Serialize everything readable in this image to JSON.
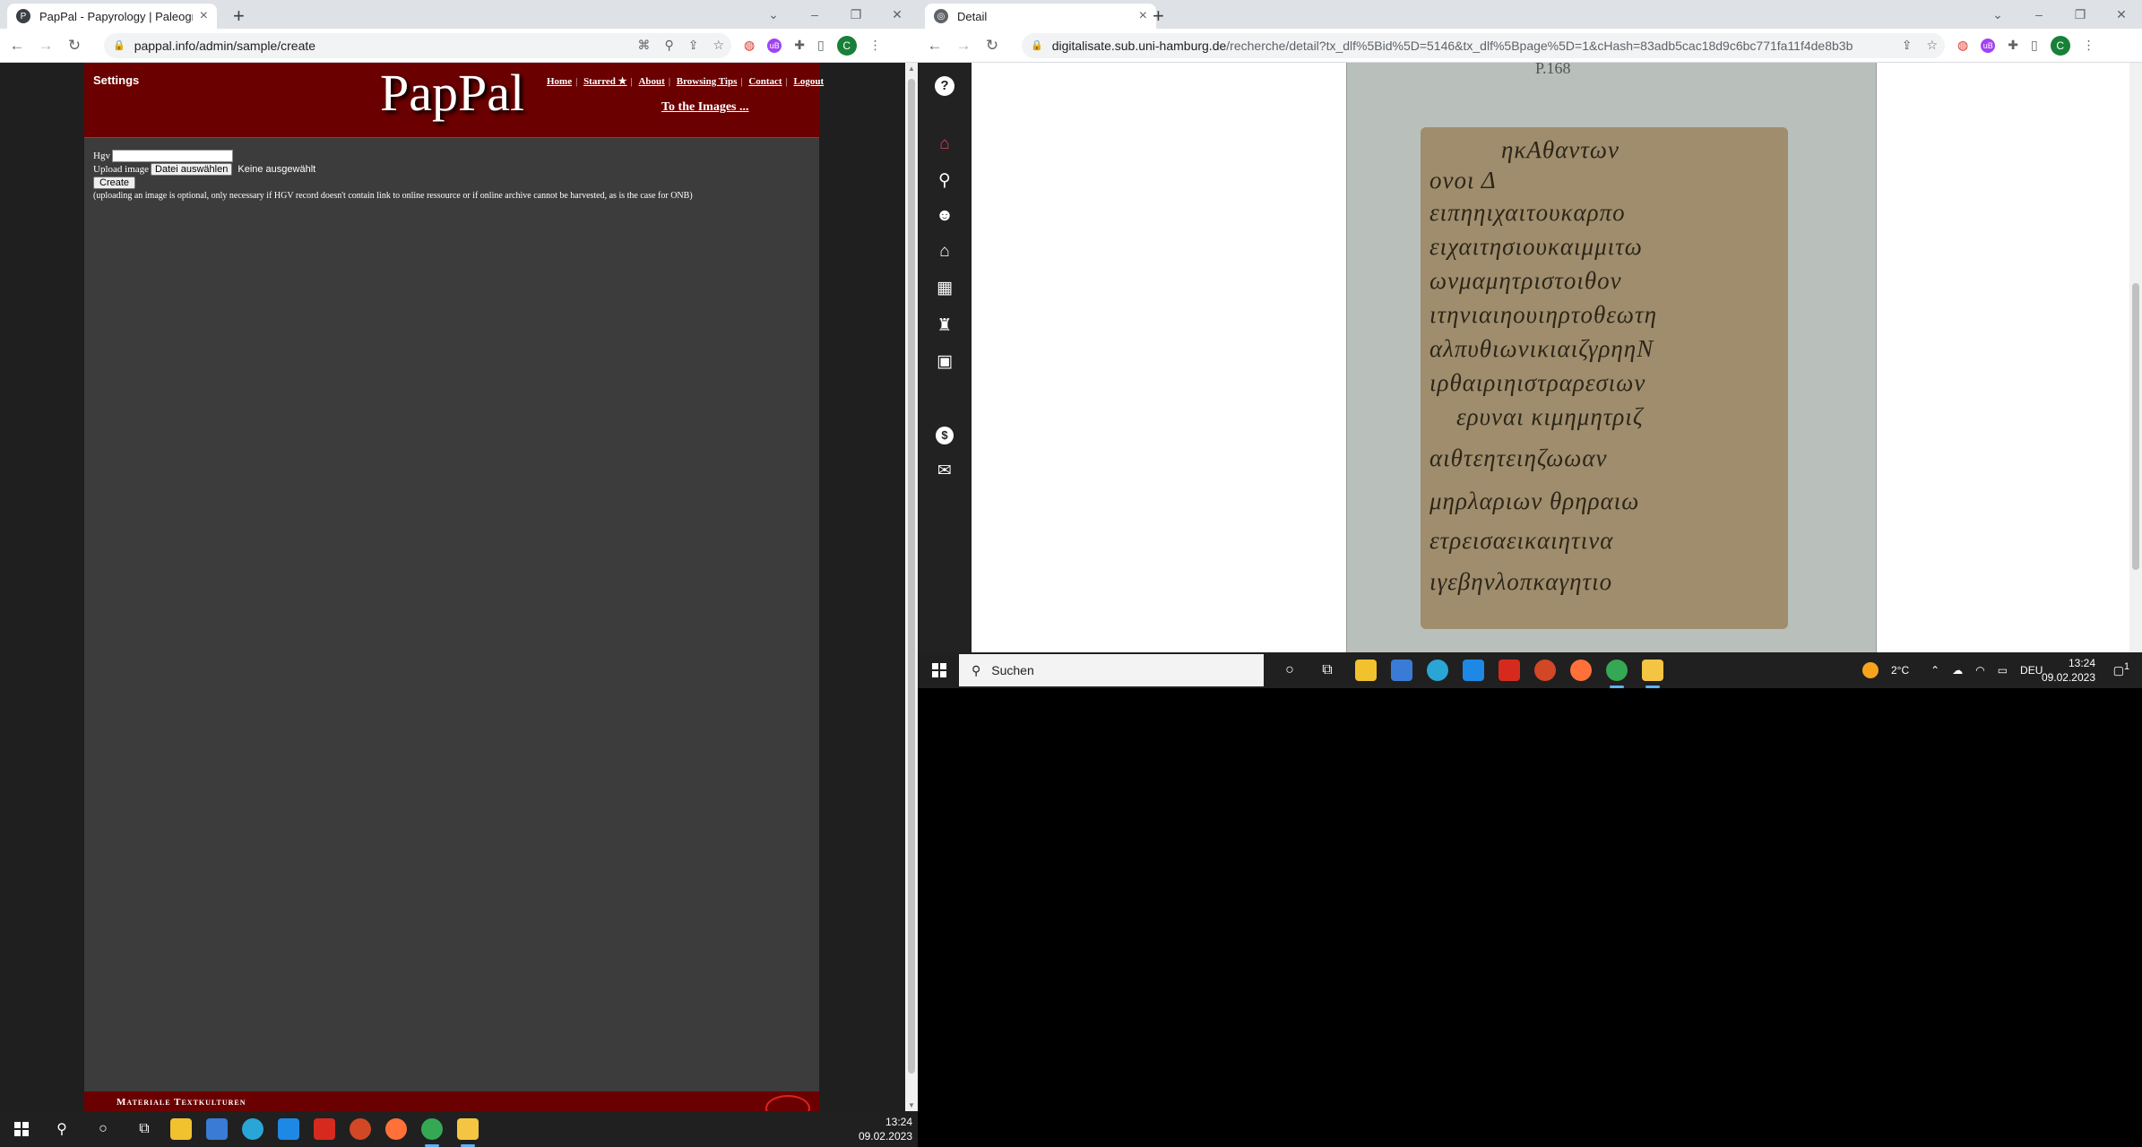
{
  "left_browser": {
    "tab_title": "PapPal - Papyrology | Paleography",
    "tab_favicon": "P",
    "url": "pappal.info/admin/sample/create",
    "avatar_letter": "C"
  },
  "pappal": {
    "settings_label": "Settings",
    "logo": "PapPal",
    "nav": [
      "Home",
      "Starred ★",
      "About",
      "Browsing Tips",
      "Contact",
      "Logout"
    ],
    "to_images": "To the Images ...",
    "form": {
      "hgv_label": "Hgv",
      "hgv_value": "",
      "upload_label": "Upload image",
      "file_button": "Datei auswählen",
      "no_file": "Keine ausgewählt",
      "create_button": "Create",
      "note": "(uploading an image is optional, only necessary if HGV record doesn't contain link to online ressource or if online archive cannot be harvested, as is the case for ONB)"
    },
    "footer_text": "Materiale Textkulturen"
  },
  "right_browser": {
    "tab_title": "Detail",
    "url_host": "digitalisate.sub.uni-hamburg.de",
    "url_path": "/recherche/detail?tx_dlf%5Bid%5D=5146&tx_dlf%5Bpage%5D=1&cHash=83adb5cac18d9c6bc771fa11f4de8b3b",
    "avatar_letter": "C",
    "sidebar_icons": [
      "help-icon",
      "home-icon",
      "search-icon",
      "feedback-icon",
      "museum-icon",
      "grid-icon",
      "chess-icon",
      "calendar-icon",
      "dollar-icon",
      "mail-icon"
    ],
    "scan_label": "P.168",
    "papyrus_lines": [
      "ηκΑθαντων",
      "ονοι Δ",
      "ειπηηιχαιτουκαρπο",
      "ειχαιτησιουκαιμμιτω",
      "ωνμαμητριστοιθον",
      "ιτηνιαιηουιηρτοθεωτη",
      "αλπυθιωνικιαιζγρηηΝ",
      "ιρθαιριηιστραρεσιων",
      "ερυναι κιμημητριζ",
      "αιθτεητειηζωωαν",
      "μηρλαριων θρηραιω",
      "ετρεισαεικαιητινα",
      "ιγεβηνλοπκαγητιο"
    ]
  },
  "taskbar_left": {
    "time": "13:24",
    "date": "09.02.2023"
  },
  "taskbar_right": {
    "search_placeholder": "Suchen",
    "weather": "2°C",
    "language": "DEU",
    "time": "13:24",
    "date": "09.02.2023",
    "notification_count": "1"
  },
  "colors": {
    "pappal_red": "#6b0000",
    "page_gray": "#3c3c3c",
    "sidebar_dark": "#222222",
    "taskbar": "#202020"
  }
}
